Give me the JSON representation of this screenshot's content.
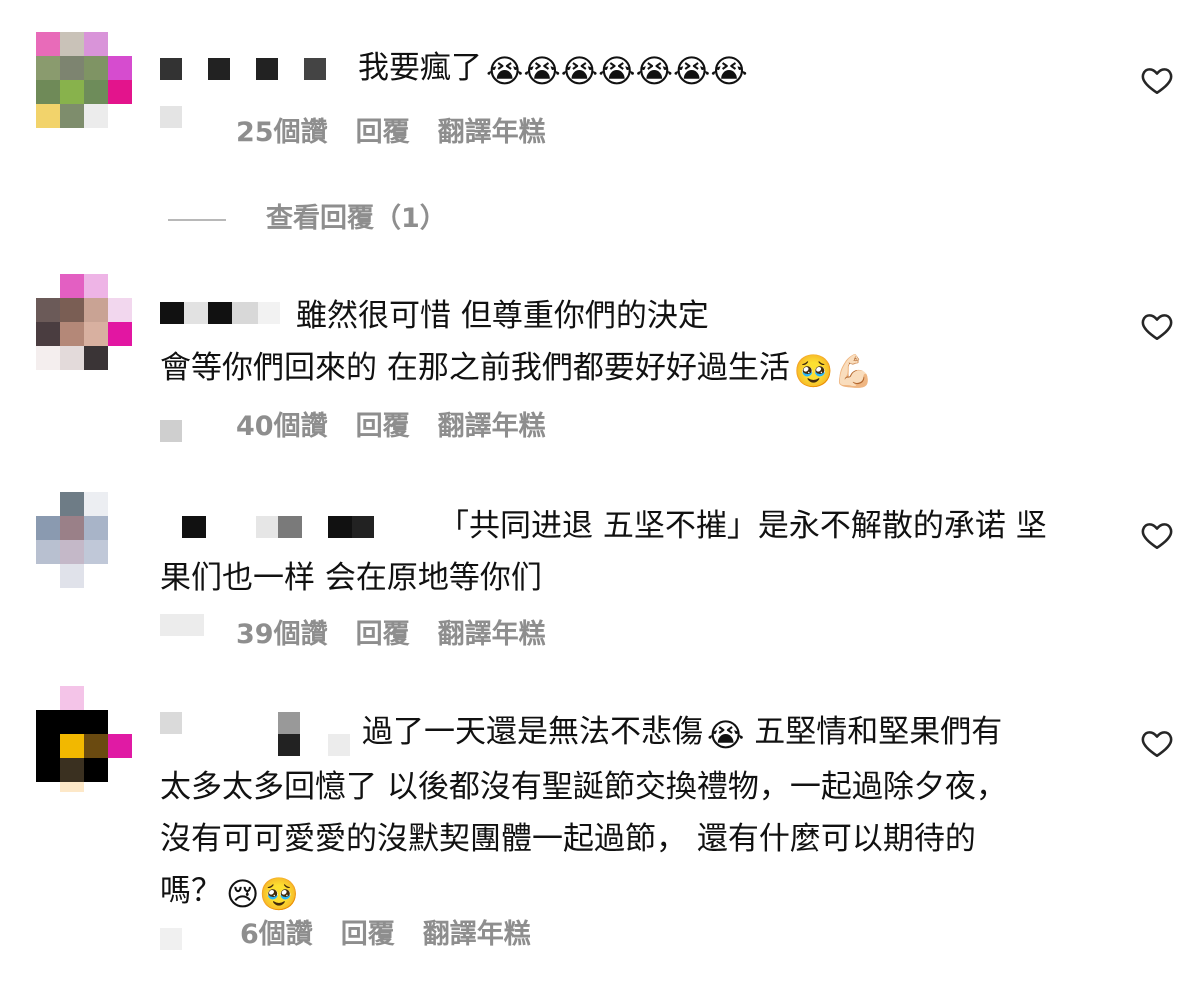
{
  "comments": [
    {
      "text_lines": [
        "我要瘋了"
      ],
      "emoji": "😭😭😭😭😭😭😭",
      "likes": "25個讚",
      "reply": "回覆",
      "translate": "翻譯年糕"
    },
    {
      "text_lines": [
        "雖然很可惜 但尊重你們的決定",
        "會等你們回來的 在那之前我們都要好好過生活"
      ],
      "emoji": "🥹💪🏻",
      "likes": "40個讚",
      "reply": "回覆",
      "translate": "翻譯年糕"
    },
    {
      "text_lines": [
        "「共同进退 五坚不摧」是永不解散的承诺 坚",
        "果们也一样 会在原地等你们"
      ],
      "likes": "39個讚",
      "reply": "回覆",
      "translate": "翻譯年糕"
    },
    {
      "text_lines": [
        "過了一天還是無法不悲傷",
        "太多太多回憶了 以後都沒有聖誕節交換禮物，一起過除夕夜，",
        "沒有可可愛愛的沒默契團體一起過節， 還有什麼可以期待的",
        "嗎？"
      ],
      "inline_emoji": "😭",
      "line1_suffix": " 五堅情和堅果們有",
      "end_emoji": "😢🥹",
      "likes": "6個讚",
      "reply": "回覆",
      "translate": "翻譯年糕"
    }
  ],
  "view_replies": "查看回覆（1）",
  "icons": {
    "like": "heart-outline-icon"
  }
}
